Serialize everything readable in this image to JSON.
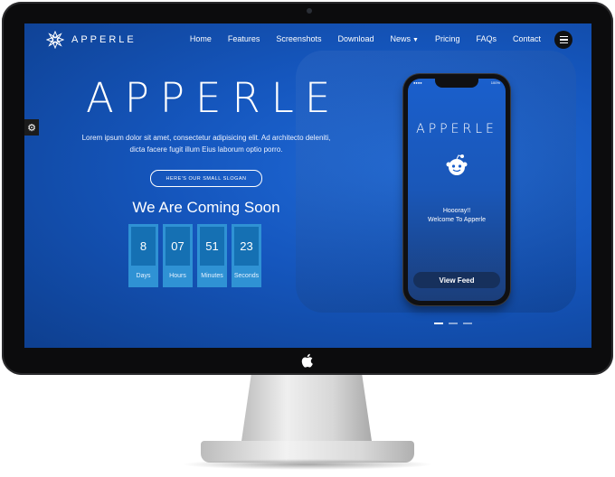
{
  "brand": {
    "name": "APPERLE",
    "icon": "mandala-logo-icon"
  },
  "nav": {
    "items": [
      "Home",
      "Features",
      "Screenshots",
      "Download",
      "News",
      "Pricing",
      "FAQs",
      "Contact"
    ],
    "menu_icon": "hamburger-icon"
  },
  "settings": {
    "icon": "gear-icon"
  },
  "hero": {
    "title": "APPERLE",
    "description": "Lorem ipsum dolor sit amet, consectetur adipisicing elit. Ad architecto deleniti, dicta facere fugit illum Eius laborum optio porro.",
    "slogan": "HERE'S OUR SMALL SLOGAN",
    "coming_soon": "We Are Coming Soon",
    "countdown": [
      {
        "value": "8",
        "label": "Days"
      },
      {
        "value": "07",
        "label": "Hours"
      },
      {
        "value": "51",
        "label": "Minutes"
      },
      {
        "value": "23",
        "label": "Seconds"
      }
    ]
  },
  "phone": {
    "status_left": "●●●●",
    "status_right": "100%",
    "title": "APPERLE",
    "icon": "robot-face-icon",
    "hooray": "Hoooray!!",
    "welcome": "Welcome To Apperle",
    "button": "View Feed"
  },
  "slider": {
    "count": 3,
    "active": 1
  },
  "colors": {
    "accent": "#1556bd",
    "countdown_box": "#2f92d4",
    "countdown_inner": "#1570b3"
  }
}
